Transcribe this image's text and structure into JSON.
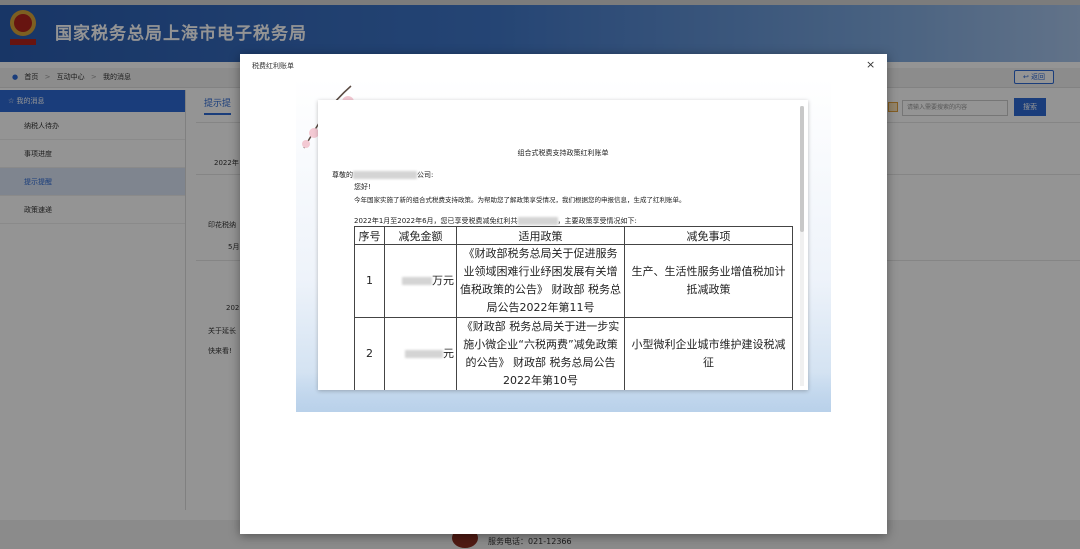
{
  "header": {
    "title": "国家税务总局上海市电子税务局"
  },
  "breadcrumb": {
    "items": [
      "首页",
      "互动中心",
      "我的消息"
    ],
    "back_label": "返回"
  },
  "sidebar": {
    "head_label": "我的消息",
    "items": [
      {
        "label": "纳税人待办"
      },
      {
        "label": "事项进度"
      },
      {
        "label": "提示提醒"
      },
      {
        "label": "政策速递"
      }
    ]
  },
  "main": {
    "tab_label": "提示提",
    "search_placeholder": "请输入需要搜索的内容",
    "search_label": "搜索",
    "rows": [
      "2022年",
      "印花税纳",
      "5月",
      "202",
      "关于延长",
      "快来看!"
    ]
  },
  "footer": {
    "text": "服务电话：021-12366"
  },
  "modal": {
    "title": "税费红利账单",
    "close": "×",
    "doc": {
      "title": "组合式税费支持政策红利账单",
      "greet_prefix": "尊敬的",
      "greet_suffix": "公司:",
      "hello": "您好!",
      "intro": "今年国家实施了新的组合式税费支持政策。为帮助您了解政策享受情况，我们根据您的申报信息，生成了红利账单。",
      "summary_prefix": "2022年1月至2022年6月，您已享受税费减免红利共",
      "summary_suffix": "，主要政策享受情况如下:",
      "table": {
        "headers": [
          "序号",
          "减免金额",
          "适用政策",
          "减免事项"
        ],
        "rows": [
          {
            "no": "1",
            "amount": "万元",
            "policy": "《财政部税务总局关于促进服务业领域困难行业纾困发展有关增值税政策的公告》 财政部 税务总局公告2022年第11号",
            "item": "生产、生活性服务业增值税加计抵减政策"
          },
          {
            "no": "2",
            "amount": "元",
            "policy": "《财政部 税务总局关于进一步实施小微企业“六税两费”减免政策的公告》 财政部 税务总局公告2022年第10号",
            "item": "小型微利企业城市维护建设税减征"
          }
        ]
      }
    }
  }
}
